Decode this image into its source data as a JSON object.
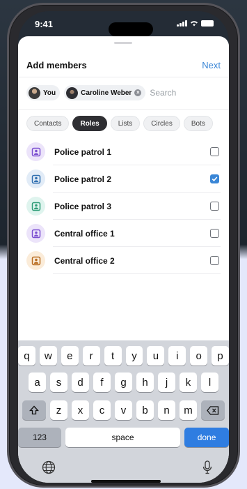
{
  "status_bar": {
    "time": "9:41"
  },
  "sheet": {
    "title": "Add members",
    "next_label": "Next"
  },
  "chips": [
    {
      "label": "You",
      "removable": false
    },
    {
      "label": "Caroline Weber",
      "removable": true
    }
  ],
  "search": {
    "placeholder": "Search"
  },
  "filters": [
    {
      "label": "Contacts",
      "active": false
    },
    {
      "label": "Roles",
      "active": true
    },
    {
      "label": "Lists",
      "active": false
    },
    {
      "label": "Circles",
      "active": false
    },
    {
      "label": "Bots",
      "active": false
    }
  ],
  "roles": [
    {
      "label": "Police patrol 1",
      "checked": false,
      "icon": "badge-icon",
      "bg": "#ece4fa",
      "fg": "#7b4fd0"
    },
    {
      "label": "Police patrol 2",
      "checked": true,
      "icon": "badge-icon",
      "bg": "#e2ecf7",
      "fg": "#2f6fb0"
    },
    {
      "label": "Police patrol 3",
      "checked": false,
      "icon": "badge-icon",
      "bg": "#dff4ee",
      "fg": "#2f9d78"
    },
    {
      "label": "Central office 1",
      "checked": false,
      "icon": "badge-icon",
      "bg": "#ece4fa",
      "fg": "#7b4fd0"
    },
    {
      "label": "Central office 2",
      "checked": false,
      "icon": "badge-icon",
      "bg": "#fbecd9",
      "fg": "#b86b1f"
    }
  ],
  "keyboard": {
    "row1": [
      "q",
      "w",
      "e",
      "r",
      "t",
      "y",
      "u",
      "i",
      "o",
      "p"
    ],
    "row2": [
      "a",
      "s",
      "d",
      "f",
      "g",
      "h",
      "j",
      "k",
      "l"
    ],
    "row3": [
      "z",
      "x",
      "c",
      "v",
      "b",
      "n",
      "m"
    ],
    "numbers_label": "123",
    "space_label": "space",
    "done_label": "done"
  },
  "colors": {
    "accent": "#3a86d6",
    "done_key": "#2f7de1"
  }
}
